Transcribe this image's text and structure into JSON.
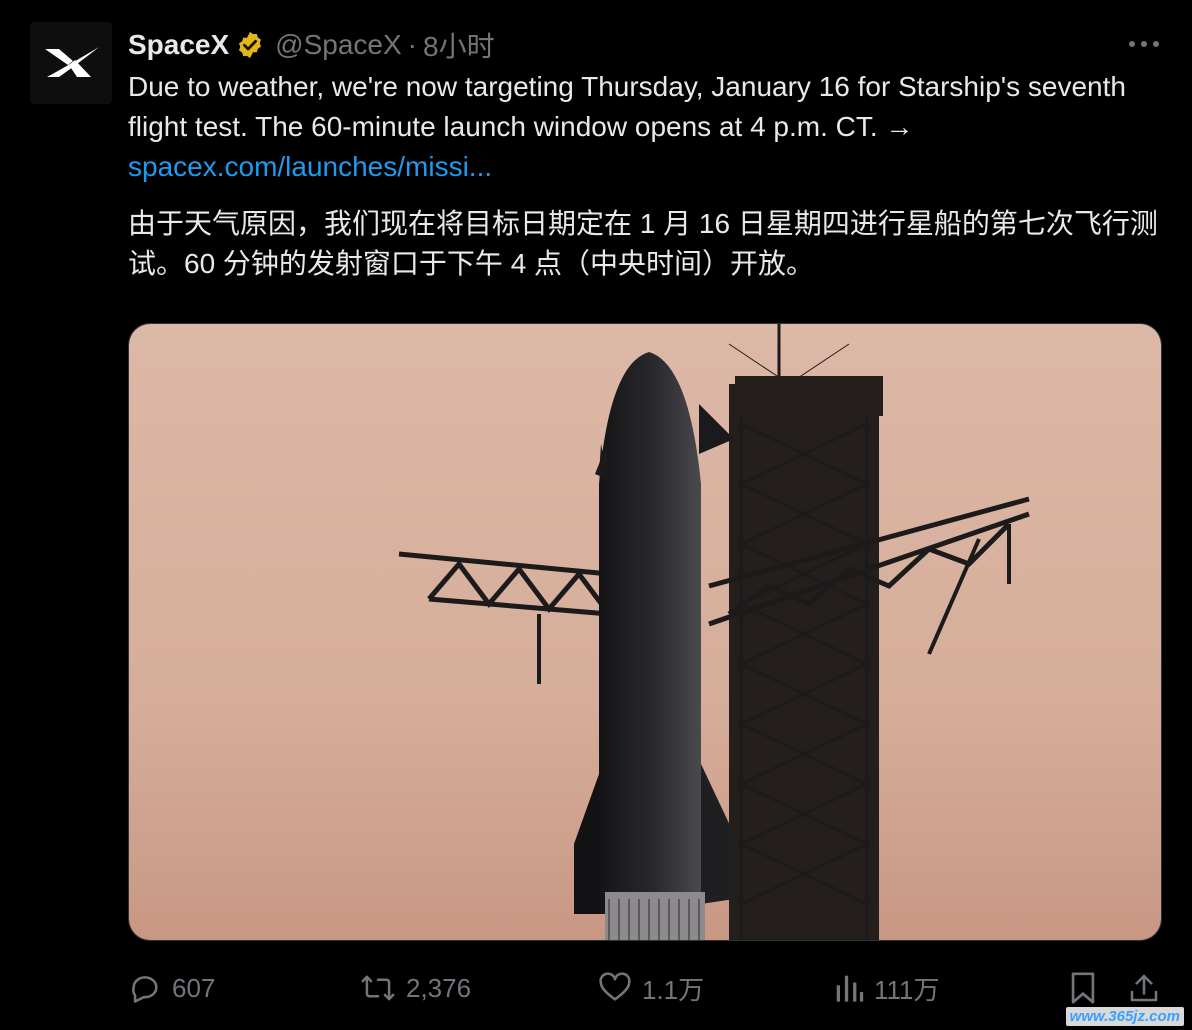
{
  "tweet": {
    "display_name": "SpaceX",
    "handle": "@SpaceX",
    "separator": "·",
    "time": "8小时",
    "text_en_part1": "Due to weather, we're now targeting Thursday, January 16 for Starship's seventh flight test. The 60-minute launch window opens at 4 p.m. CT. →",
    "link_text": "spacex.com/launches/missi...",
    "text_zh": "由于天气原因，我们现在将目标日期定在 1 月 16 日星期四进行星船的第七次飞行测试。60 分钟的发射窗口于下午 4 点（中央时间）开放。"
  },
  "actions": {
    "replies": "607",
    "retweets": "2,376",
    "likes": "1.1万",
    "views": "111万"
  },
  "watermark": "www.365jz.com",
  "colors": {
    "background": "#000000",
    "text": "#e7e9ea",
    "muted": "#71767b",
    "link": "#1d9bf0",
    "verified_badge": "#e2b719",
    "sky": "#d9b3a0"
  },
  "icons": [
    "spacex-logo",
    "verified-badge-icon",
    "more-icon",
    "reply-icon",
    "retweet-icon",
    "like-icon",
    "views-icon",
    "bookmark-icon",
    "share-icon"
  ]
}
